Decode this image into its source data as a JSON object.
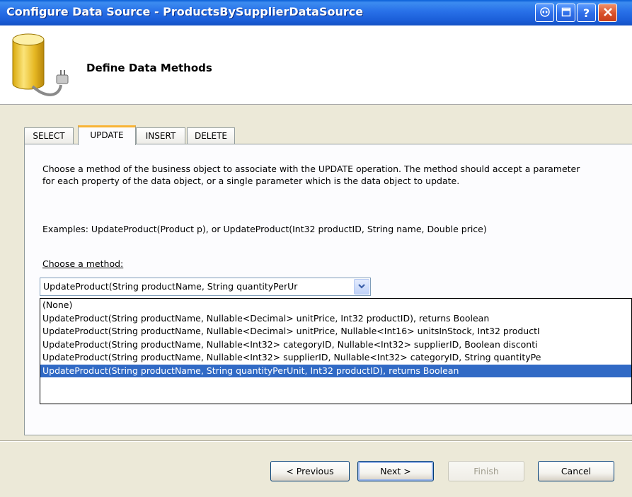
{
  "window": {
    "title": "Configure Data Source - ProductsBySupplierDataSource",
    "controls": [
      "restore-icon",
      "maximize-icon",
      "help-icon",
      "close-icon"
    ],
    "help_label": "?"
  },
  "header": {
    "title": "Define Data Methods",
    "icon": "database-icon"
  },
  "tabs": [
    {
      "label": "SELECT",
      "active": false
    },
    {
      "label": "UPDATE",
      "active": true
    },
    {
      "label": "INSERT",
      "active": false
    },
    {
      "label": "DELETE",
      "active": false
    }
  ],
  "content": {
    "description": "Choose a method of the business object to associate with the UPDATE operation. The method should accept a parameter for each property of the data object, or a single parameter which is the data object to update.",
    "examples": "Examples: UpdateProduct(Product p), or UpdateProduct(Int32 productID, String name, Double price)",
    "choose_label": "Choose a method:"
  },
  "combo": {
    "value": "UpdateProduct(String productName, String quantityPerUr",
    "options": [
      "(None)",
      "UpdateProduct(String productName, Nullable<Decimal> unitPrice, Int32 productID), returns Boolean",
      "UpdateProduct(String productName, Nullable<Decimal> unitPrice, Nullable<Int16> unitsInStock, Int32 productI",
      "UpdateProduct(String productName, Nullable<Int32> categoryID, Nullable<Int32> supplierID, Boolean disconti",
      "UpdateProduct(String productName, Nullable<Int32> supplierID, Nullable<Int32> categoryID, String quantityPe",
      "UpdateProduct(String productName, String quantityPerUnit, Int32 productID), returns Boolean"
    ],
    "selected_index": 5
  },
  "buttons": {
    "previous": "< Previous",
    "next": "Next >",
    "finish": "Finish",
    "cancel": "Cancel"
  },
  "colors": {
    "titlebar": "#2870e8",
    "selection": "#316ac5",
    "active_tab_accent": "#f8b334",
    "dialog_background": "#ece9d8"
  }
}
